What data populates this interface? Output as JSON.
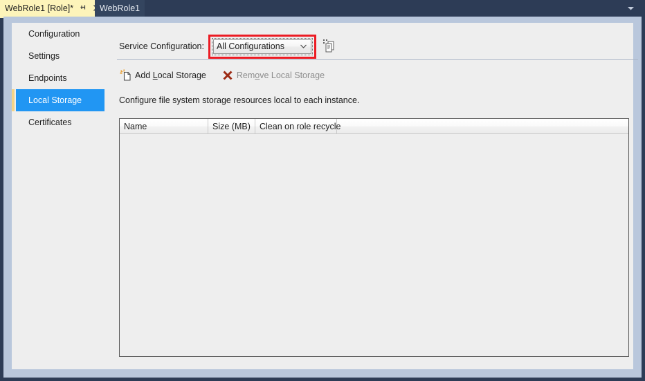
{
  "window": {
    "tabs": [
      {
        "label": "WebRole1 [Role]*",
        "pin_icon": "pin-icon",
        "close_icon": "close-icon",
        "active": true
      },
      {
        "label": "WebRole1",
        "active": false
      }
    ],
    "overflow_icon": "chevron-down-icon"
  },
  "sidebar": {
    "items": [
      {
        "label": "Configuration",
        "selected": false
      },
      {
        "label": "Settings",
        "selected": false
      },
      {
        "label": "Endpoints",
        "selected": false
      },
      {
        "label": "Local Storage",
        "selected": true
      },
      {
        "label": "Certificates",
        "selected": false
      }
    ]
  },
  "service_configuration": {
    "label": "Service Configuration:",
    "selected_value": "All Configurations",
    "options": [
      "All Configurations"
    ],
    "dropdown_arrow_icon": "chevron-down-icon",
    "copy_icon": "copy-configuration-icon",
    "highlight_color": "#ec1c24"
  },
  "command_bar": {
    "add_button": {
      "label_before": "Add ",
      "accelerator": "L",
      "label_after": "ocal Storage",
      "icon": "add-document-icon",
      "enabled": true
    },
    "remove_button": {
      "label_before": "Rem",
      "accelerator": "o",
      "label_after": "ve Local Storage",
      "icon": "delete-x-icon",
      "enabled": false
    }
  },
  "grid": {
    "description": "Configure file system storage resources local to each instance.",
    "columns": [
      "Name",
      "Size (MB)",
      "Clean on role recycle"
    ],
    "rows": []
  },
  "colors": {
    "accent_blue": "#2196f3",
    "tab_active_yellow": "#fdf4ba",
    "frame_navy": "#2d3c56",
    "gutter_blue": "#b9c7dc",
    "panel_grey": "#eeeeee"
  }
}
